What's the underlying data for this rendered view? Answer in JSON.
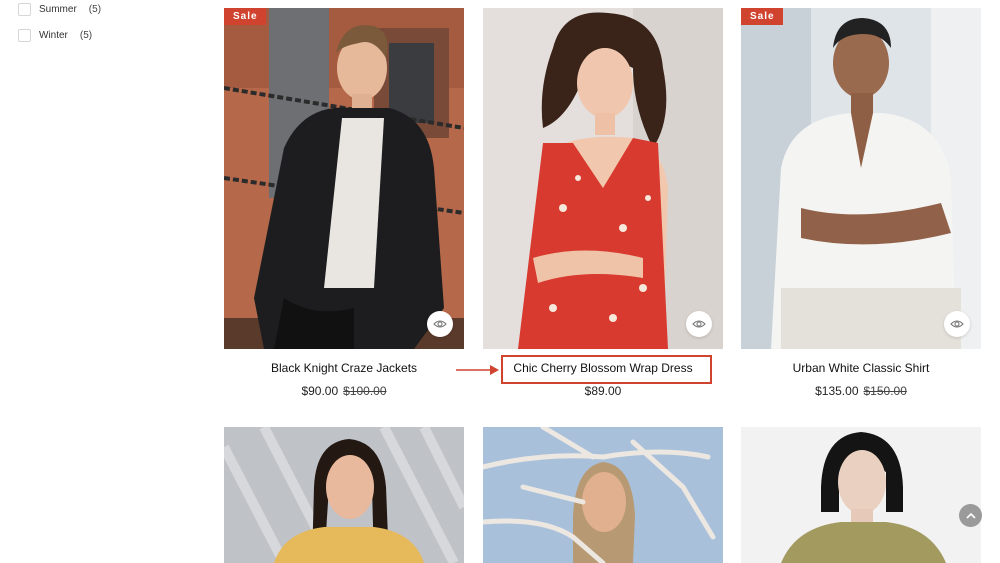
{
  "sidebar": {
    "filters": [
      {
        "label": "Summer",
        "count": "(5)"
      },
      {
        "label": "Winter",
        "count": "(5)"
      }
    ]
  },
  "products": [
    {
      "name": "Black Knight Craze Jackets",
      "price": "$90.00",
      "old_price": "$100.00",
      "badge": "Sale"
    },
    {
      "name": "Chic Cherry Blossom Wrap Dress",
      "price": "$89.00",
      "old_price": "",
      "badge": ""
    },
    {
      "name": "Urban White Classic Shirt",
      "price": "$135.00",
      "old_price": "$150.00",
      "badge": "Sale"
    }
  ],
  "colors": {
    "accent": "#d0432f",
    "text": "#111111",
    "scroll_button": "#9a9a9a"
  }
}
